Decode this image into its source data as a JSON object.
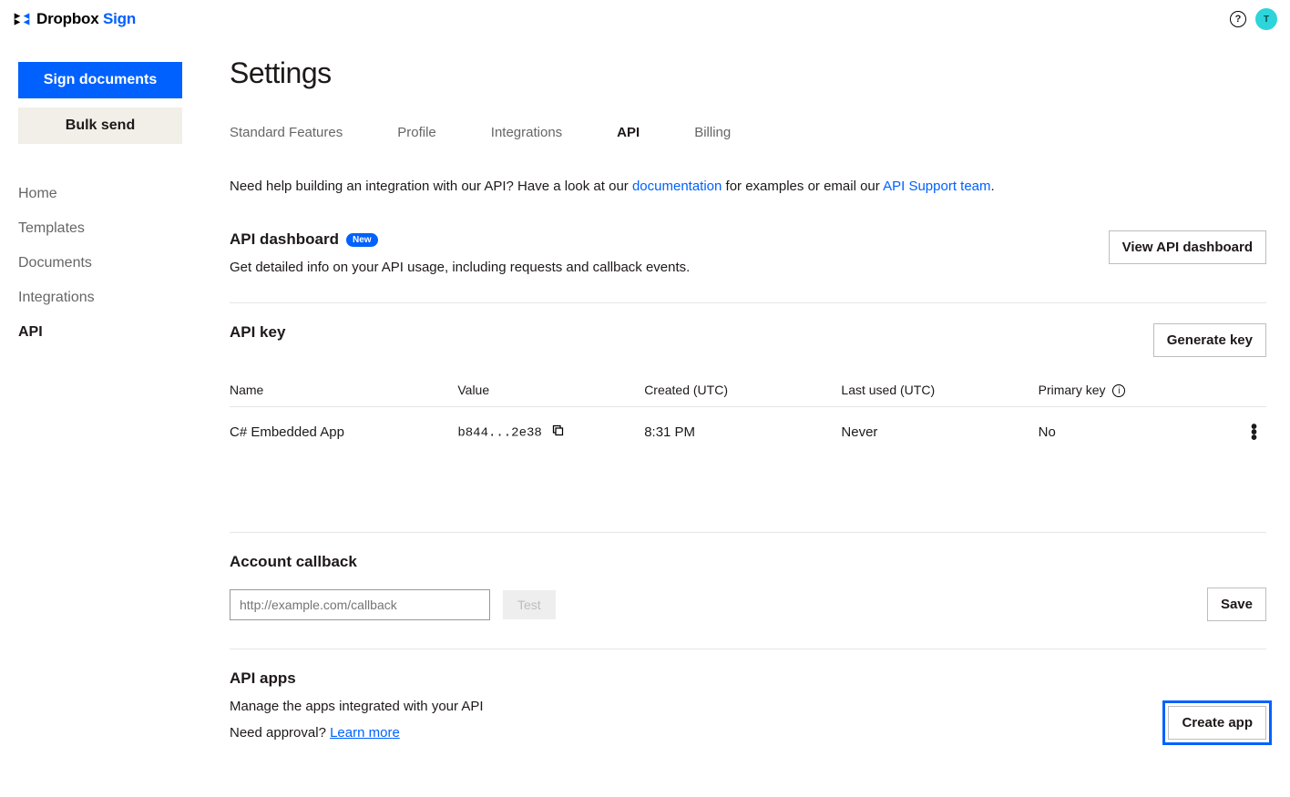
{
  "brand": {
    "name1": "Dropbox",
    "name2": "Sign"
  },
  "topbar": {
    "help_glyph": "?",
    "avatar_initial": "T"
  },
  "sidebar": {
    "sign_documents": "Sign documents",
    "bulk_send": "Bulk send",
    "nav": {
      "home": "Home",
      "templates": "Templates",
      "documents": "Documents",
      "integrations": "Integrations",
      "api": "API"
    }
  },
  "page": {
    "title": "Settings"
  },
  "tabs": {
    "standard": "Standard Features",
    "profile": "Profile",
    "integrations": "Integrations",
    "api": "API",
    "billing": "Billing"
  },
  "help": {
    "prefix": "Need help building an integration with our API? Have a look at our ",
    "doc_link": "documentation",
    "mid": " for examples or email our ",
    "support_link": "API Support team",
    "suffix": "."
  },
  "dashboard": {
    "title": "API dashboard",
    "badge": "New",
    "desc": "Get detailed info on your API usage, including requests and callback events.",
    "button": "View API dashboard"
  },
  "apikey": {
    "title": "API key",
    "generate": "Generate key",
    "cols": {
      "name": "Name",
      "value": "Value",
      "created": "Created (UTC)",
      "lastused": "Last used (UTC)",
      "primary": "Primary key"
    },
    "row": {
      "name": "C# Embedded App",
      "value": "b844...2e38",
      "created": "8:31 PM",
      "lastused": "Never",
      "primary": "No"
    }
  },
  "callback": {
    "title": "Account callback",
    "placeholder": "http://example.com/callback",
    "test": "Test",
    "save": "Save"
  },
  "apps": {
    "title": "API apps",
    "desc": "Manage the apps integrated with your API",
    "approval_prefix": "Need approval? ",
    "learn_more": "Learn more",
    "create": "Create app"
  }
}
